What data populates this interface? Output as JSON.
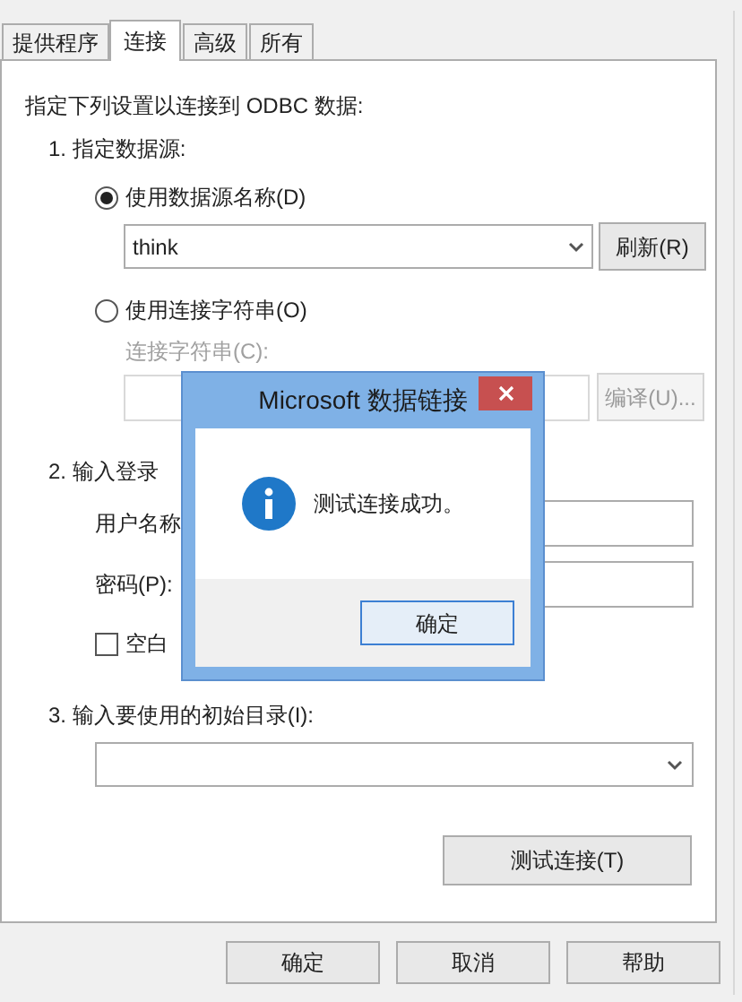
{
  "tabs": [
    {
      "label": "提供程序",
      "selected": false
    },
    {
      "label": "连接",
      "selected": true
    },
    {
      "label": "高级",
      "selected": false
    },
    {
      "label": "所有",
      "selected": false
    }
  ],
  "intro": "指定下列设置以连接到 ODBC 数据:",
  "step1": {
    "heading": "1. 指定数据源:",
    "options": [
      {
        "label": "使用数据源名称(D)",
        "selected": true
      },
      {
        "label": "使用连接字符串(O)",
        "selected": false
      }
    ],
    "data_source": {
      "value": "think"
    },
    "refresh_button": "刷新(R)",
    "connection_string": {
      "label": "连接字符串(C):",
      "disabled": true
    },
    "build_button": {
      "label": "编译(U)...",
      "disabled": true
    }
  },
  "step2": {
    "heading": "2. 输入登录",
    "username_label": "用户名称",
    "password_label": "密码(P):",
    "blank_password": {
      "label": "空白",
      "checked": false
    }
  },
  "step3": {
    "heading": "3. 输入要使用的初始目录(I):"
  },
  "test_button": "测试连接(T)",
  "buttons": [
    "确定",
    "取消",
    "帮助"
  ],
  "message_box": {
    "title": "Microsoft 数据链接",
    "message": "测试连接成功。",
    "ok_button": "确定"
  }
}
